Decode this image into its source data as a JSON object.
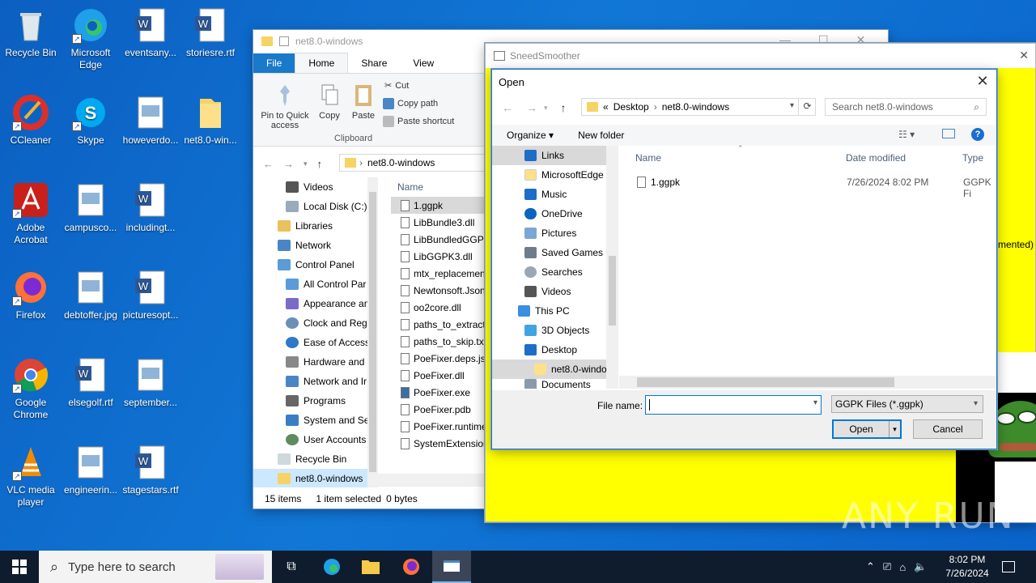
{
  "desktop": {
    "icons": [
      {
        "label": "Recycle Bin"
      },
      {
        "label": "Microsoft Edge"
      },
      {
        "label": "eventsany..."
      },
      {
        "label": "storiesre.rtf"
      },
      {
        "label": "CCleaner"
      },
      {
        "label": "Skype"
      },
      {
        "label": "howeverdo..."
      },
      {
        "label": "net8.0-win..."
      },
      {
        "label": "Adobe Acrobat"
      },
      {
        "label": "campusco..."
      },
      {
        "label": "includingt..."
      },
      {
        "label": "Firefox"
      },
      {
        "label": "debtoffer.jpg"
      },
      {
        "label": "picturesopt..."
      },
      {
        "label": "Google Chrome"
      },
      {
        "label": "elsegolf.rtf"
      },
      {
        "label": "september..."
      },
      {
        "label": "VLC media player"
      },
      {
        "label": "engineerin..."
      },
      {
        "label": "stagestars.rtf"
      }
    ]
  },
  "explorer": {
    "title": "net8.0-windows",
    "tabs": [
      "File",
      "Home",
      "Share",
      "View"
    ],
    "ribbon": {
      "pin": "Pin to Quick access",
      "copy": "Copy",
      "paste": "Paste",
      "cut": "Cut",
      "copy_path": "Copy path",
      "paste_shortcut": "Paste shortcut",
      "group": "Clipboard"
    },
    "address": "net8.0-windows",
    "nav_items": [
      "Videos",
      "Local Disk (C:)",
      "Libraries",
      "Network",
      "Control Panel",
      "All Control Par",
      "Appearance an",
      "Clock and Regi",
      "Ease of Access",
      "Hardware and",
      "Network and Ir",
      "Programs",
      "System and Se",
      "User Accounts",
      "Recycle Bin",
      "net8.0-windows"
    ],
    "column_name": "Name",
    "files": [
      "1.ggpk",
      "LibBundle3.dll",
      "LibBundledGGPK",
      "LibGGPK3.dll",
      "mtx_replacemen",
      "Newtonsoft.Json",
      "oo2core.dll",
      "paths_to_extract",
      "paths_to_skip.txt",
      "PoeFixer.deps.jso",
      "PoeFixer.dll",
      "PoeFixer.exe",
      "PoeFixer.pdb",
      "PoeFixer.runtime",
      "SystemExtension"
    ],
    "status": {
      "count": "15 items",
      "selected": "1 item selected",
      "size": "0 bytes"
    }
  },
  "sneed": {
    "title": "SneedSmoother",
    "partial_text": "emented)"
  },
  "dialog": {
    "title": "Open",
    "breadcrumb": [
      "Desktop",
      "net8.0-windows"
    ],
    "breadcrumb_prefix": "«",
    "search_placeholder": "Search net8.0-windows",
    "organize": "Organize",
    "new_folder": "New folder",
    "tree": [
      "Links",
      "MicrosoftEdge",
      "Music",
      "OneDrive",
      "Pictures",
      "Saved Games",
      "Searches",
      "Videos",
      "This PC",
      "3D Objects",
      "Desktop",
      "net8.0-windo",
      "Documents"
    ],
    "columns": {
      "name": "Name",
      "date": "Date modified",
      "type": "Type"
    },
    "file": {
      "name": "1.ggpk",
      "date": "7/26/2024 8:02 PM",
      "type": "GGPK Fi"
    },
    "filename_label": "File name:",
    "filename_value": "",
    "filetype": "GGPK Files (*.ggpk)",
    "open_button": "Open",
    "cancel_button": "Cancel"
  },
  "taskbar": {
    "search_placeholder": "Type here to search",
    "time": "8:02 PM",
    "date": "7/26/2024"
  },
  "watermark": "ANY RUN"
}
